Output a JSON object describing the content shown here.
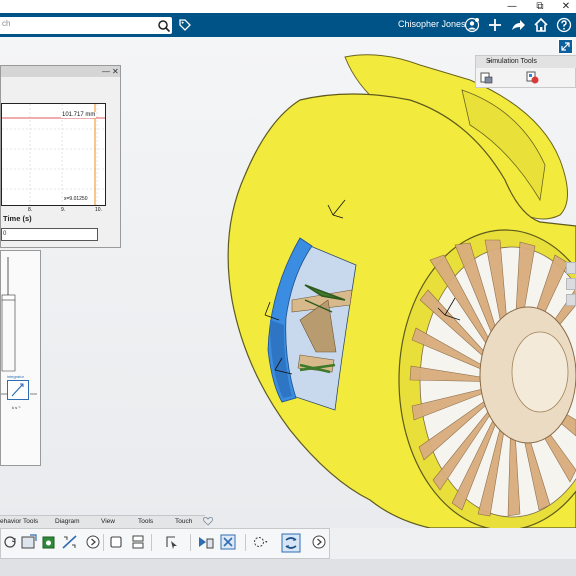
{
  "window": {
    "minimize_glyph": "—",
    "maximize_glyph": "⧉",
    "close_glyph": "✕"
  },
  "topbar": {
    "search_placeholder": "ch",
    "user_name": "Chisopher Jones",
    "icons": [
      "search-icon",
      "tag-icon",
      "user-icon",
      "plus-icon",
      "share-icon",
      "home-icon",
      "help-icon"
    ],
    "accent": "#005386"
  },
  "sim_panel": {
    "title": "Simulation Tools",
    "collapse_glyph": "▾",
    "tools": [
      "simulation-setup-icon",
      "run-simulation-icon"
    ]
  },
  "plot_window": {
    "minimize_glyph": "—",
    "close_glyph": "✕",
    "max_label": "101.717 mm",
    "current_label": "x=9.01250",
    "x_ticks": [
      "8.",
      "9.",
      "10."
    ],
    "x_axis_label": "Time (s)",
    "input_value": "0",
    "curve_color": "#e35b5b",
    "marker_color": "#f0a040"
  },
  "diagram": {
    "block_label": "integrator",
    "block_sub": "k s⁻¹"
  },
  "bottom_tabs": [
    "ehavior Tools",
    "Diagram",
    "View",
    "Tools",
    "Touch"
  ],
  "toolbar": {
    "buttons": [
      "cycle-icon",
      "save-model-icon",
      "camera-icon",
      "simulate-icon",
      "next-icon",
      "block-icon",
      "layout-icon",
      "select-icon",
      "compare-icon",
      "cross-icon",
      "dropdown-icon",
      "sync-icon",
      "arrow-icon"
    ]
  },
  "colors": {
    "engine_yellow": "#f2ea3c",
    "blade_tan": "#d9ad7e",
    "section_blue": "#3a8de0"
  }
}
